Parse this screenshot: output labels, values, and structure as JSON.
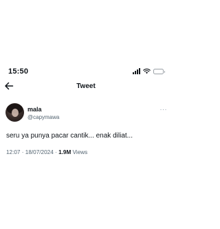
{
  "status_bar": {
    "time": "15:50",
    "icons": [
      "signal-icon",
      "wifi-icon",
      "battery-icon"
    ]
  },
  "nav": {
    "title": "Tweet",
    "back_icon": "arrow-left-icon"
  },
  "tweet": {
    "display_name": "mala",
    "handle": "@capymawa",
    "text": "seru ya punya pacar cantik... enak diliat...",
    "time": "12:07",
    "separator": "·",
    "date": "18/07/2024",
    "views_count": "1.9M",
    "views_label": "Views",
    "more_label": "···"
  },
  "colors": {
    "text_primary": "#0f1419",
    "text_secondary": "#536471",
    "background": "#ffffff"
  }
}
